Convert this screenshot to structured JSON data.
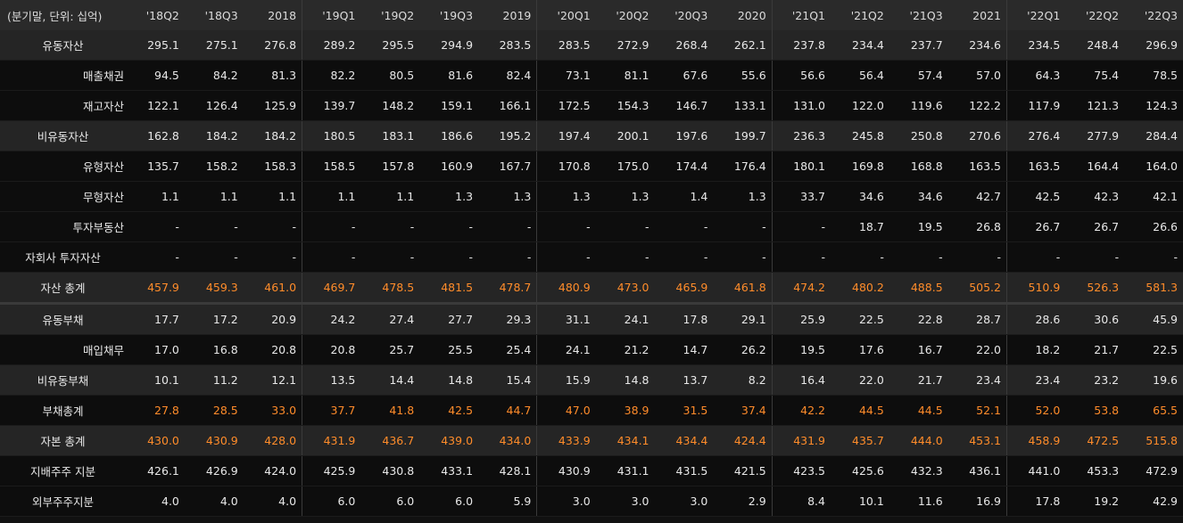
{
  "header": {
    "unit_label": "(분기말, 단위: 십억)",
    "columns": [
      "'18Q2",
      "'18Q3",
      "2018",
      "'19Q1",
      "'19Q2",
      "'19Q3",
      "2019",
      "'20Q1",
      "'20Q2",
      "'20Q3",
      "2020",
      "'21Q1",
      "'21Q2",
      "'21Q3",
      "2021",
      "'22Q1",
      "'22Q2",
      "'22Q3"
    ]
  },
  "rows": [
    {
      "label": "유동자산",
      "values": [
        "295.1",
        "275.1",
        "276.8",
        "289.2",
        "295.5",
        "294.9",
        "283.5",
        "283.5",
        "272.9",
        "268.4",
        "262.1",
        "237.8",
        "234.4",
        "237.7",
        "234.6",
        "234.5",
        "248.4",
        "296.9"
      ]
    },
    {
      "label": "매출채권",
      "values": [
        "94.5",
        "84.2",
        "81.3",
        "82.2",
        "80.5",
        "81.6",
        "82.4",
        "73.1",
        "81.1",
        "67.6",
        "55.6",
        "56.6",
        "56.4",
        "57.4",
        "57.0",
        "64.3",
        "75.4",
        "78.5"
      ]
    },
    {
      "label": "재고자산",
      "values": [
        "122.1",
        "126.4",
        "125.9",
        "139.7",
        "148.2",
        "159.1",
        "166.1",
        "172.5",
        "154.3",
        "146.7",
        "133.1",
        "131.0",
        "122.0",
        "119.6",
        "122.2",
        "117.9",
        "121.3",
        "124.3"
      ]
    },
    {
      "label": "비유동자산",
      "values": [
        "162.8",
        "184.2",
        "184.2",
        "180.5",
        "183.1",
        "186.6",
        "195.2",
        "197.4",
        "200.1",
        "197.6",
        "199.7",
        "236.3",
        "245.8",
        "250.8",
        "270.6",
        "276.4",
        "277.9",
        "284.4"
      ]
    },
    {
      "label": "유형자산",
      "values": [
        "135.7",
        "158.2",
        "158.3",
        "158.5",
        "157.8",
        "160.9",
        "167.7",
        "170.8",
        "175.0",
        "174.4",
        "176.4",
        "180.1",
        "169.8",
        "168.8",
        "163.5",
        "163.5",
        "164.4",
        "164.0"
      ]
    },
    {
      "label": "무형자산",
      "values": [
        "1.1",
        "1.1",
        "1.1",
        "1.1",
        "1.1",
        "1.3",
        "1.3",
        "1.3",
        "1.3",
        "1.4",
        "1.3",
        "33.7",
        "34.6",
        "34.6",
        "42.7",
        "42.5",
        "42.3",
        "42.1"
      ]
    },
    {
      "label": "투자부동산",
      "values": [
        "-",
        "-",
        "-",
        "-",
        "-",
        "-",
        "-",
        "-",
        "-",
        "-",
        "-",
        "-",
        "18.7",
        "19.5",
        "26.8",
        "26.7",
        "26.7",
        "26.6"
      ]
    },
    {
      "label": "자회사 투자자산",
      "values": [
        "-",
        "-",
        "-",
        "-",
        "-",
        "-",
        "-",
        "-",
        "-",
        "-",
        "-",
        "-",
        "-",
        "-",
        "-",
        "-",
        "-",
        "-"
      ]
    },
    {
      "label": "자산 총계",
      "values": [
        "457.9",
        "459.3",
        "461.0",
        "469.7",
        "478.5",
        "481.5",
        "478.7",
        "480.9",
        "473.0",
        "465.9",
        "461.8",
        "474.2",
        "480.2",
        "488.5",
        "505.2",
        "510.9",
        "526.3",
        "581.3"
      ]
    },
    {
      "label": "유동부채",
      "values": [
        "17.7",
        "17.2",
        "20.9",
        "24.2",
        "27.4",
        "27.7",
        "29.3",
        "31.1",
        "24.1",
        "17.8",
        "29.1",
        "25.9",
        "22.5",
        "22.8",
        "28.7",
        "28.6",
        "30.6",
        "45.9"
      ]
    },
    {
      "label": "매입채무",
      "values": [
        "17.0",
        "16.8",
        "20.8",
        "20.8",
        "25.7",
        "25.5",
        "25.4",
        "24.1",
        "21.2",
        "14.7",
        "26.2",
        "19.5",
        "17.6",
        "16.7",
        "22.0",
        "18.2",
        "21.7",
        "22.5"
      ]
    },
    {
      "label": "비유동부채",
      "values": [
        "10.1",
        "11.2",
        "12.1",
        "13.5",
        "14.4",
        "14.8",
        "15.4",
        "15.9",
        "14.8",
        "13.7",
        "8.2",
        "16.4",
        "22.0",
        "21.7",
        "23.4",
        "23.4",
        "23.2",
        "19.6"
      ]
    },
    {
      "label": "부채총계",
      "values": [
        "27.8",
        "28.5",
        "33.0",
        "37.7",
        "41.8",
        "42.5",
        "44.7",
        "47.0",
        "38.9",
        "31.5",
        "37.4",
        "42.2",
        "44.5",
        "44.5",
        "52.1",
        "52.0",
        "53.8",
        "65.5"
      ]
    },
    {
      "label": "자본 총계",
      "values": [
        "430.0",
        "430.9",
        "428.0",
        "431.9",
        "436.7",
        "439.0",
        "434.0",
        "433.9",
        "434.1",
        "434.4",
        "424.4",
        "431.9",
        "435.7",
        "444.0",
        "453.1",
        "458.9",
        "472.5",
        "515.8"
      ]
    },
    {
      "label": "지배주주 지분",
      "values": [
        "426.1",
        "426.9",
        "424.0",
        "425.9",
        "430.8",
        "433.1",
        "428.1",
        "430.9",
        "431.1",
        "431.5",
        "421.5",
        "423.5",
        "425.6",
        "432.3",
        "436.1",
        "441.0",
        "453.3",
        "472.9"
      ]
    },
    {
      "label": "외부주주지분",
      "values": [
        "4.0",
        "4.0",
        "4.0",
        "6.0",
        "6.0",
        "6.0",
        "5.9",
        "3.0",
        "3.0",
        "3.0",
        "2.9",
        "8.4",
        "10.1",
        "11.6",
        "16.9",
        "17.8",
        "19.2",
        "42.9"
      ]
    }
  ],
  "colors": {
    "highlight": "#ff8c2a",
    "header_bg": "#2a2a2a",
    "grey_row": "#252525",
    "dark_row": "#0d0d0d"
  }
}
